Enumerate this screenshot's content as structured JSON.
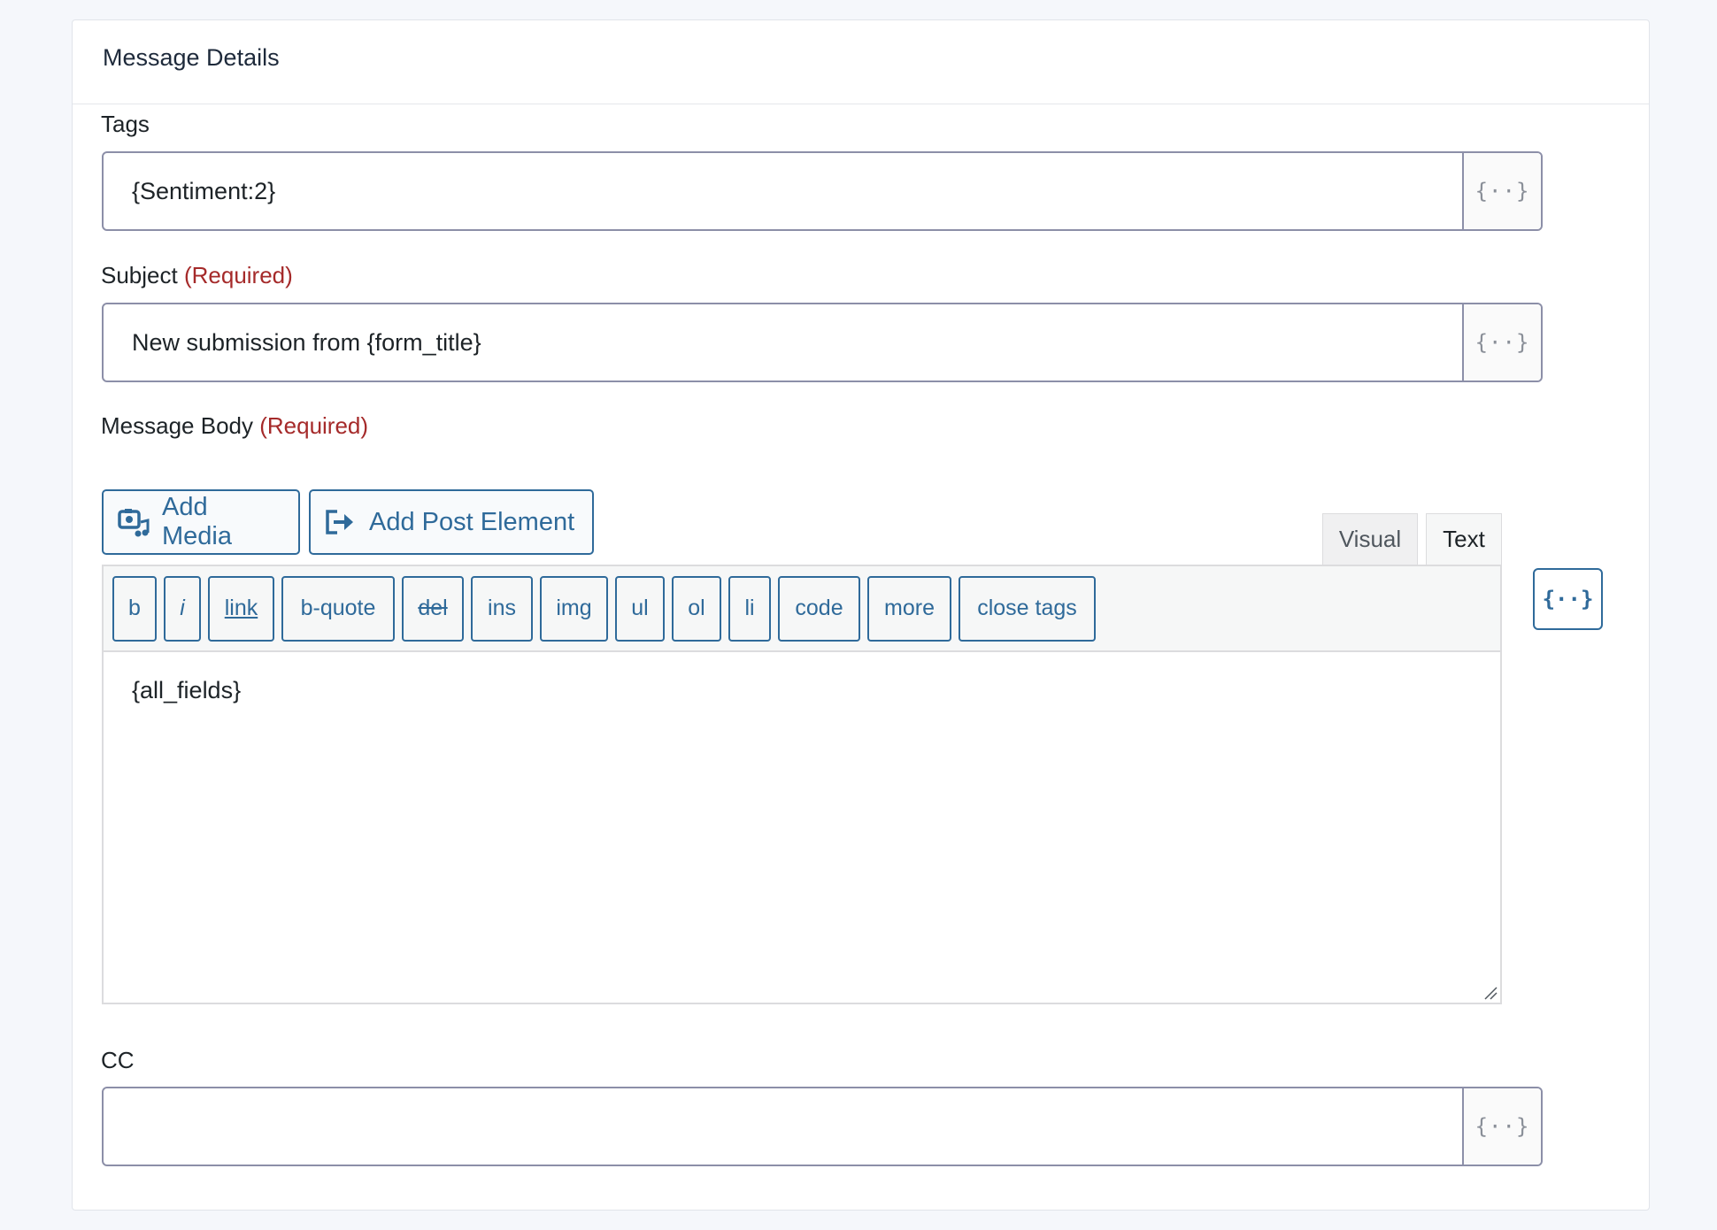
{
  "panel": {
    "title": "Message Details"
  },
  "tags": {
    "label": "Tags",
    "value": "{Sentiment:2}",
    "merge_icon": "{··}"
  },
  "subject": {
    "label": "Subject",
    "required": "(Required)",
    "value": "New submission from {form_title}",
    "merge_icon": "{··}"
  },
  "message_body": {
    "label": "Message Body",
    "required": "(Required)",
    "add_media_label": "Add Media",
    "add_post_element_label": "Add Post Element",
    "tabs": {
      "visual": "Visual",
      "text": "Text"
    },
    "quicktags": [
      "b",
      "i",
      "link",
      "b-quote",
      "del",
      "ins",
      "img",
      "ul",
      "ol",
      "li",
      "code",
      "more",
      "close tags"
    ],
    "content": "{all_fields}",
    "merge_icon": "{··}"
  },
  "cc": {
    "label": "CC",
    "value": "",
    "merge_icon": "{··}"
  },
  "colors": {
    "accent": "#2f6a9a",
    "required": "#a52a2a",
    "input_border": "#8c8fa8"
  }
}
